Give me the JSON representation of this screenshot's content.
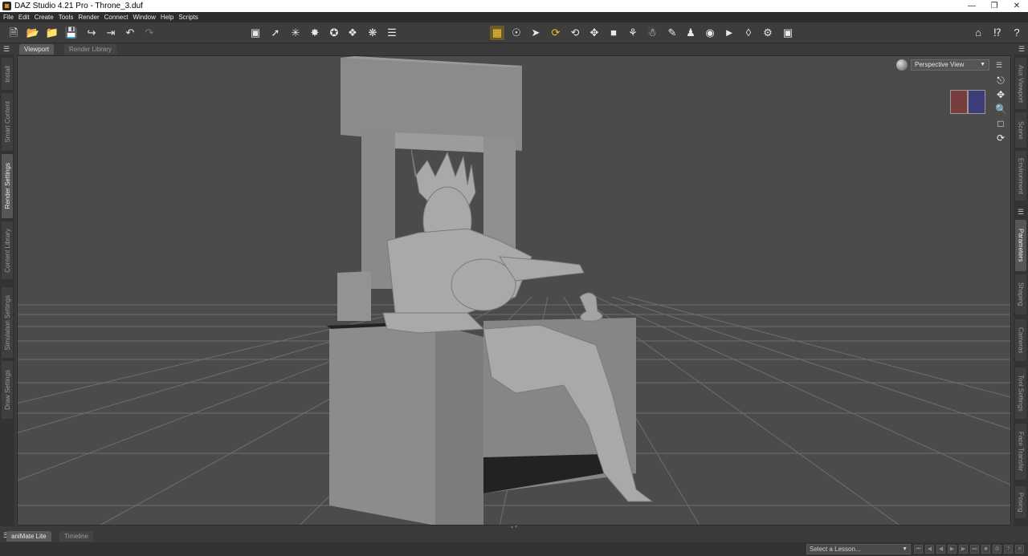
{
  "window": {
    "title": "DAZ Studio 4.21 Pro - Throne_3.duf"
  },
  "menu": [
    "File",
    "Edit",
    "Create",
    "Tools",
    "Render",
    "Connect",
    "Window",
    "Help",
    "Scripts"
  ],
  "tabs": {
    "viewport": "Viewport",
    "render_library": "Render Library"
  },
  "left_panels": [
    "Install",
    "Smart Content",
    "Render Settings",
    "Content Library",
    "Simulation Settings",
    "Draw Settings"
  ],
  "right_panels": [
    "Aux Viewport",
    "Scene",
    "Environment",
    "Parameters",
    "Shaping",
    "Cameras",
    "Tool Settings",
    "Face Transfer",
    "Posing"
  ],
  "viewport": {
    "view_name": "Perspective View"
  },
  "bottom_tabs": {
    "animate": "aniMate Lite",
    "timeline": "Timeline"
  },
  "lesson": {
    "placeholder": "Select a Lesson..."
  },
  "colors": {
    "accent": "#f0c030",
    "background": "#4a4a4a"
  }
}
